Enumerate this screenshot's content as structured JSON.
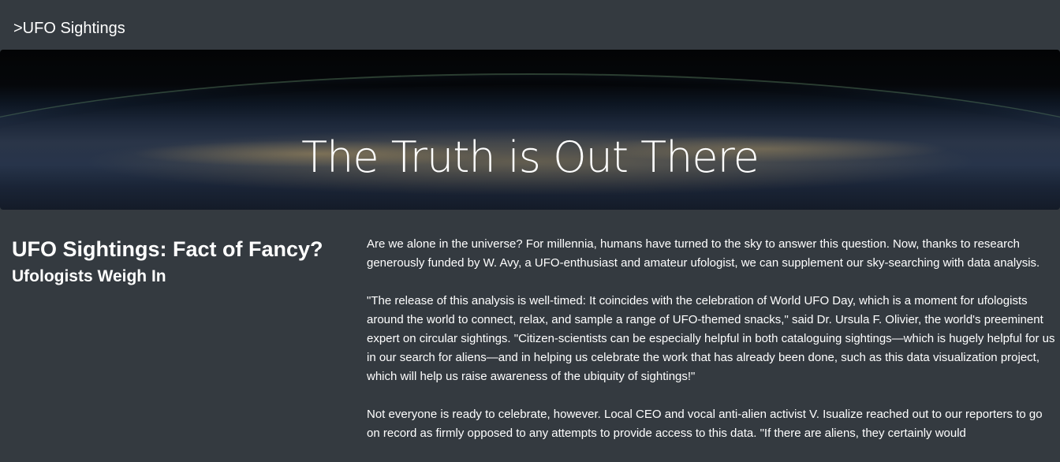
{
  "nav": {
    "brand": ">UFO Sightings"
  },
  "hero": {
    "title": "The Truth is Out There"
  },
  "article": {
    "title": "UFO Sightings: Fact of Fancy?",
    "subtitle": "Ufologists Weigh In",
    "paragraphs": [
      "Are we alone in the universe? For millennia, humans have turned to the sky to answer this question. Now, thanks to research generously funded by W. Avy, a UFO-enthusiast and amateur ufologist, we can supplement our sky-searching with data analysis.",
      "\"The release of this analysis is well-timed: It coincides with the celebration of World UFO Day, which is a moment for ufologists around the world to connect, relax, and sample a range of UFO-themed snacks,\" said Dr. Ursula F. Olivier, the world's preeminent expert on circular sightings. \"Citizen-scientists can be especially helpful in both cataloguing sightings—which is hugely helpful for us in our search for aliens—and in helping us celebrate the work that has already been done, such as this data visualization project, which will help us raise awareness of the ubiquity of sightings!\"",
      "Not everyone is ready to celebrate, however. Local CEO and vocal anti-alien activist V. Isualize reached out to our reporters to go on record as firmly opposed to any attempts to provide access to this data. \"If there are aliens, they certainly would"
    ]
  }
}
